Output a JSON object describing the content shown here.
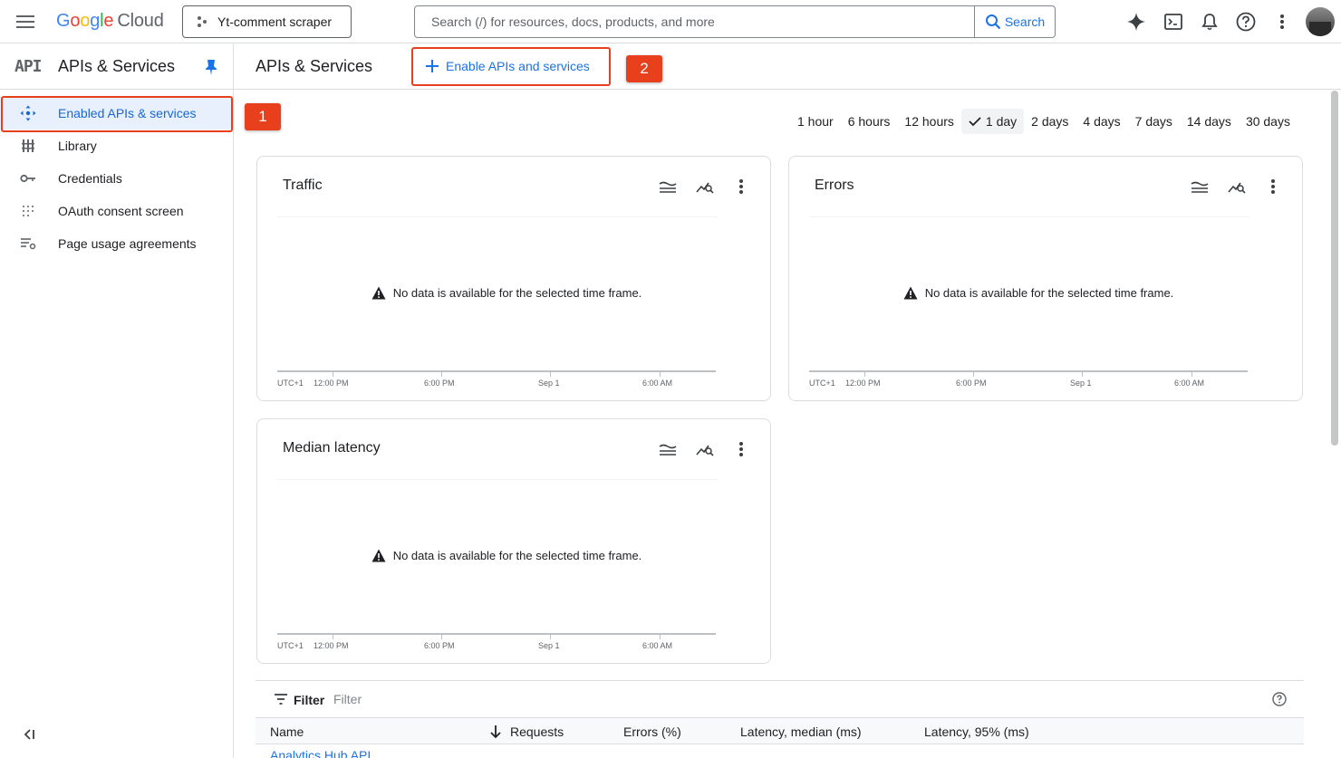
{
  "topbar": {
    "logo_google": [
      "G",
      "o",
      "o",
      "g",
      "l",
      "e"
    ],
    "logo_cloud": "Cloud",
    "project_name": "Yt-comment scraper",
    "search_placeholder": "Search (/) for resources, docs, products, and more",
    "search_button": "Search",
    "icons": [
      "menu-icon",
      "gemini-sparkle-icon",
      "cloud-shell-icon",
      "notifications-icon",
      "help-icon",
      "more-vert-icon"
    ]
  },
  "sidebar": {
    "api_logo": "API",
    "title": "APIs & Services",
    "items": [
      {
        "label": "Enabled APIs & services",
        "icon": "enabled-apis-icon",
        "active": true
      },
      {
        "label": "Library",
        "icon": "library-icon"
      },
      {
        "label": "Credentials",
        "icon": "key-icon"
      },
      {
        "label": "OAuth consent screen",
        "icon": "oauth-icon"
      },
      {
        "label": "Page usage agreements",
        "icon": "agreements-icon"
      }
    ]
  },
  "callouts": {
    "badge1": "1",
    "badge2": "2",
    "color": "#e8401c"
  },
  "main": {
    "title": "APIs & Services",
    "enable_button": "Enable APIs and services"
  },
  "time_filters": [
    {
      "label": "1 hour"
    },
    {
      "label": "6 hours"
    },
    {
      "label": "12 hours"
    },
    {
      "label": "1 day",
      "selected": true
    },
    {
      "label": "2 days"
    },
    {
      "label": "4 days"
    },
    {
      "label": "7 days"
    },
    {
      "label": "14 days"
    },
    {
      "label": "30 days"
    }
  ],
  "charts": [
    {
      "title": "Traffic"
    },
    {
      "title": "Errors"
    },
    {
      "title": "Median latency"
    }
  ],
  "chart_common": {
    "no_data": "No data is available for the selected time frame.",
    "timezone": "UTC+1",
    "ticks": [
      "12:00 PM",
      "6:00 PM",
      "Sep 1",
      "6:00 AM"
    ]
  },
  "table": {
    "filter_label": "Filter",
    "filter_placeholder": "Filter",
    "columns": [
      "Name",
      "Requests",
      "Errors (%)",
      "Latency, median (ms)",
      "Latency, 95% (ms)"
    ],
    "sort_column": "Requests",
    "rows": [
      {
        "name": "Analytics Hub API"
      }
    ]
  },
  "colors": {
    "accent": "#1a73e8",
    "active_bg": "#e8f0fe",
    "callout": "#e8401c",
    "border": "#dadce0"
  }
}
